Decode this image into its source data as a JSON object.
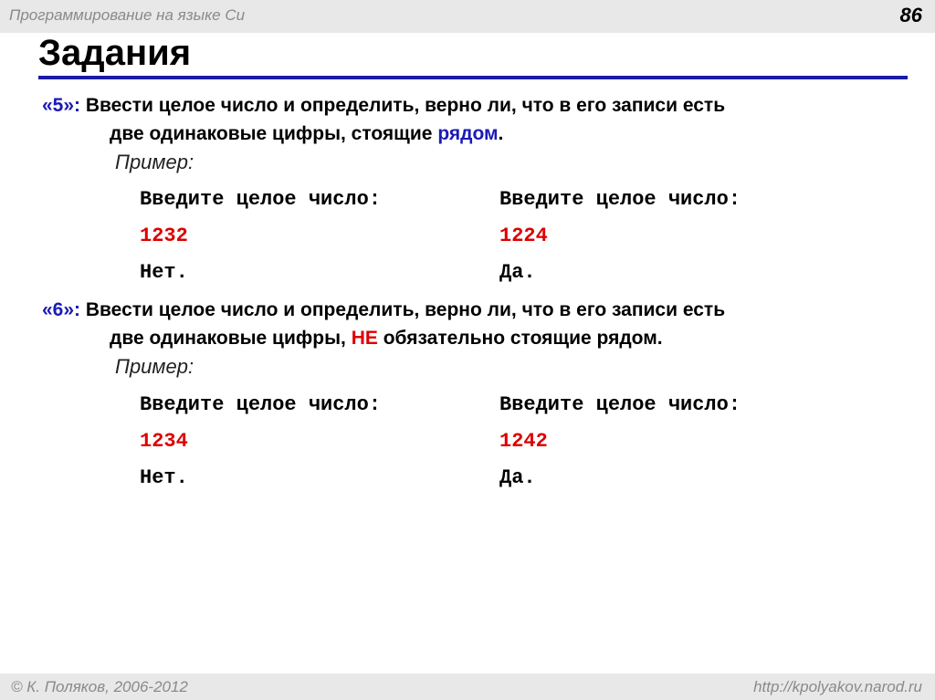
{
  "header": {
    "course": "Программирование на языке Си",
    "page_number": "86"
  },
  "title": "Задания",
  "tasks": [
    {
      "number": "«5»:",
      "line1": " Ввести целое число и определить, верно ли, что в его записи есть",
      "line2_before": "две одинаковые цифры, стоящие ",
      "line2_highlight": "рядом",
      "line2_after": ".",
      "example_label": "Пример:",
      "left": {
        "prompt": "Введите целое число:",
        "input": "1232",
        "result": "Нет."
      },
      "right": {
        "prompt": "Введите целое число:",
        "input": "1224",
        "result": "Да."
      }
    },
    {
      "number": "«6»:",
      "line1": " Ввести целое число и определить, верно ли, что в его записи есть",
      "line2_before": "две одинаковые цифры, ",
      "line2_highlight": "НЕ",
      "line2_after": " обязательно стоящие рядом.",
      "example_label": "Пример:",
      "left": {
        "prompt": "Введите целое число:",
        "input": "1234",
        "result": "Нет."
      },
      "right": {
        "prompt": "Введите целое число:",
        "input": "1242",
        "result": "Да."
      }
    }
  ],
  "footer": {
    "author": "© К. Поляков, 2006-2012",
    "url": "http://kpolyakov.narod.ru"
  }
}
